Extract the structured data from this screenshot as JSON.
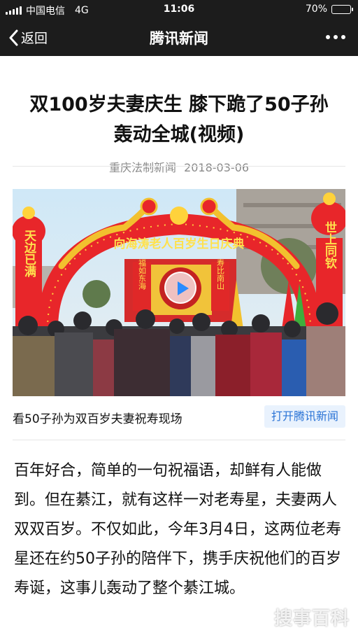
{
  "status_bar": {
    "carrier": "中国电信",
    "network": "4G",
    "time": "11:06",
    "battery": "70%",
    "battery_level": 0.7
  },
  "nav": {
    "back_label": "返回",
    "title": "腾讯新闻",
    "more_icon": "more-dots-icon"
  },
  "article": {
    "title": "双100岁夫妻庆生 膝下跪了50子孙轰动全城(视频)",
    "source": "重庆法制新闻",
    "date": "2018-03-06",
    "video": {
      "arch_text": "向海涛老人百岁生日庆典",
      "pillar_left": "天边已满",
      "pillar_right": "世上同钦",
      "board_left": "福如东海",
      "board_right": "寿比南山",
      "caption": "看50子孙为双百岁夫妻祝寿现场",
      "open_button": "打开腾讯新闻"
    },
    "body": "百年好合，简单的一句祝福语，却鲜有人能做到。但在綦江，就有这样一对老寿星，夫妻两人双双百岁。不仅如此，今年3月4日，这两位老寿星还在约50子孙的陪伴下，携手庆祝他们的百岁寿诞，这事儿轰动了整个綦江城。"
  },
  "watermark": "搜事百科",
  "colors": {
    "bar_bg": "#1c1c1c",
    "link_blue": "#2b74d6",
    "arch_red": "#e8262a",
    "dragon_gold": "#f2c12e"
  }
}
